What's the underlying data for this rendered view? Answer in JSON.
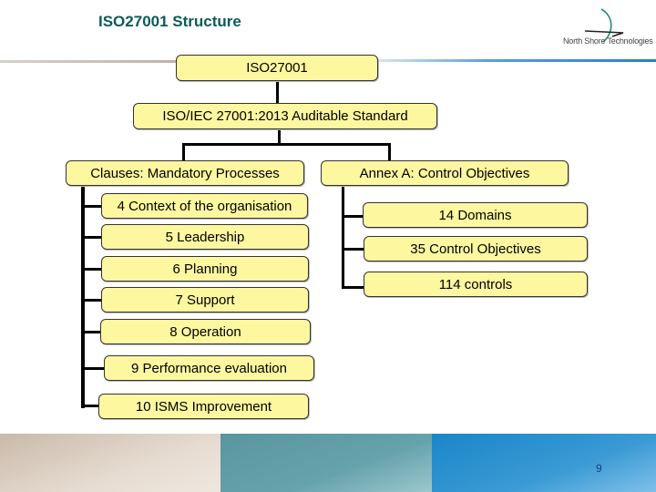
{
  "slide": {
    "title": "ISO27001 Structure",
    "logo_text": "North Shore Technologies",
    "page_number": "9"
  },
  "diagram": {
    "root": "ISO27001",
    "standard": "ISO/IEC 27001:2013 Auditable Standard",
    "clauses": {
      "label": "Clauses: Mandatory Processes",
      "items": [
        "4 Context of the organisation",
        "5 Leadership",
        "6 Planning",
        "7 Support",
        "8 Operation",
        "9 Performance evaluation",
        "10 ISMS Improvement"
      ]
    },
    "annex": {
      "label": "Annex A: Control Objectives",
      "items": [
        "14 Domains",
        "35 Control Objectives",
        "114 controls"
      ]
    }
  },
  "colors": {
    "box_fill": "#fdf7a0",
    "title": "#0e5a5a"
  }
}
